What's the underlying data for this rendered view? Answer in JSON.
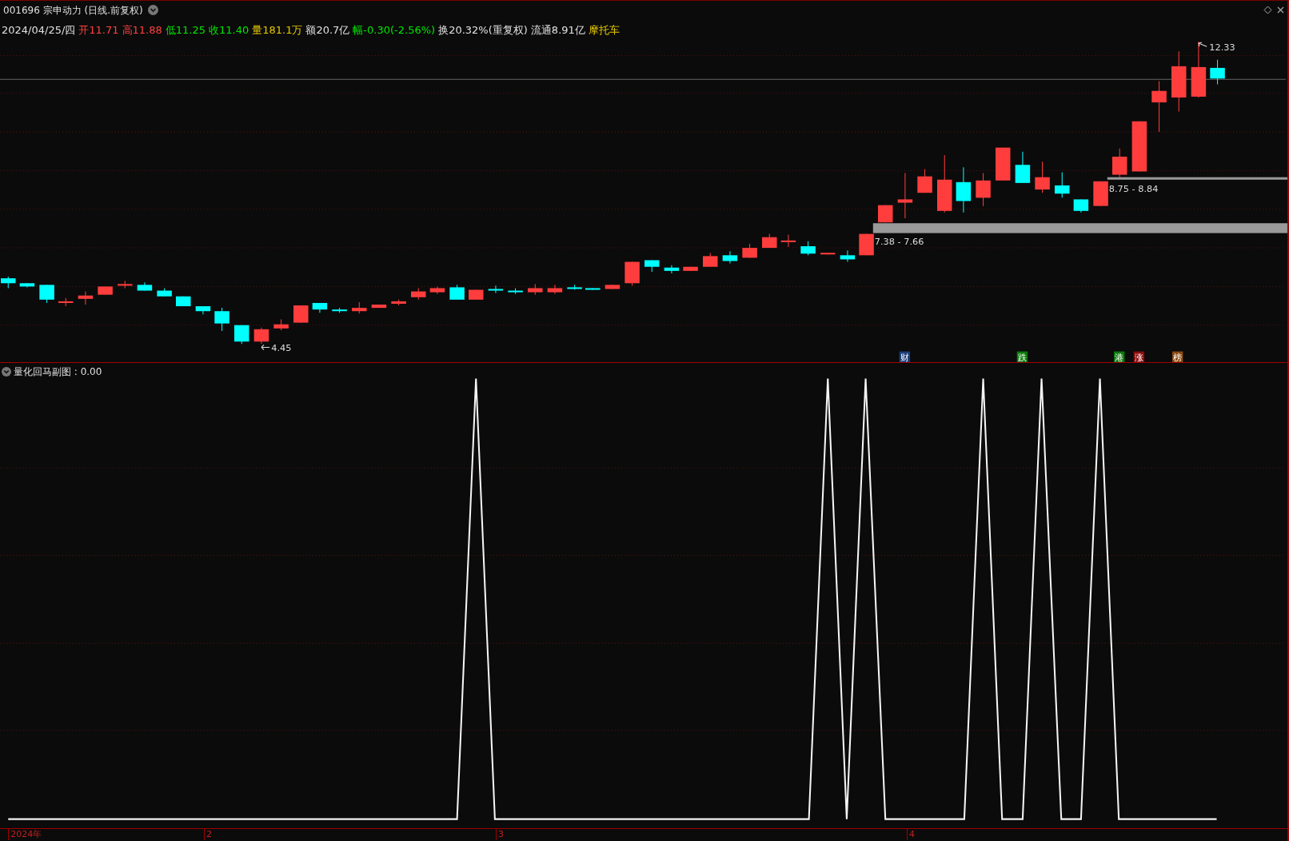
{
  "title": {
    "code": "001696",
    "name": "宗申动力",
    "period": "(日线.前复权)"
  },
  "quote": [
    {
      "text": "2024/04/25/四",
      "color": "#e0e0e0"
    },
    {
      "text": "开11.71",
      "color": "#ff4040"
    },
    {
      "text": "高11.88",
      "color": "#ff4040"
    },
    {
      "text": "低11.25",
      "color": "#00e600"
    },
    {
      "text": "收11.40",
      "color": "#00e600"
    },
    {
      "text": "量181.1万",
      "color": "#e6c800"
    },
    {
      "text": "额20.7亿",
      "color": "#e0e0e0"
    },
    {
      "text": "幅-0.30(-2.56%)",
      "color": "#00e600"
    },
    {
      "text": "换20.32%(重复权)",
      "color": "#e0e0e0"
    },
    {
      "text": "流通8.91亿",
      "color": "#e0e0e0"
    },
    {
      "text": "摩托车",
      "color": "#e6c800"
    }
  ],
  "chart": {
    "low_label": "4.45",
    "high_label": "12.33",
    "zones": [
      "7.38 - 7.66",
      "8.75 - 8.84"
    ],
    "events": [
      {
        "text": "财",
        "color": "#1d3f7a"
      },
      {
        "text": "跌",
        "color": "#0a7a0a"
      },
      {
        "text": "港",
        "color": "#0a7a0a"
      },
      {
        "text": "涨",
        "color": "#8a0c0c"
      },
      {
        "text": "榜",
        "color": "#8a4a10"
      }
    ]
  },
  "indicator": {
    "title": "量化回马副图 : 0.00"
  },
  "axis": [
    "2024年",
    "2",
    "3",
    "4"
  ]
}
